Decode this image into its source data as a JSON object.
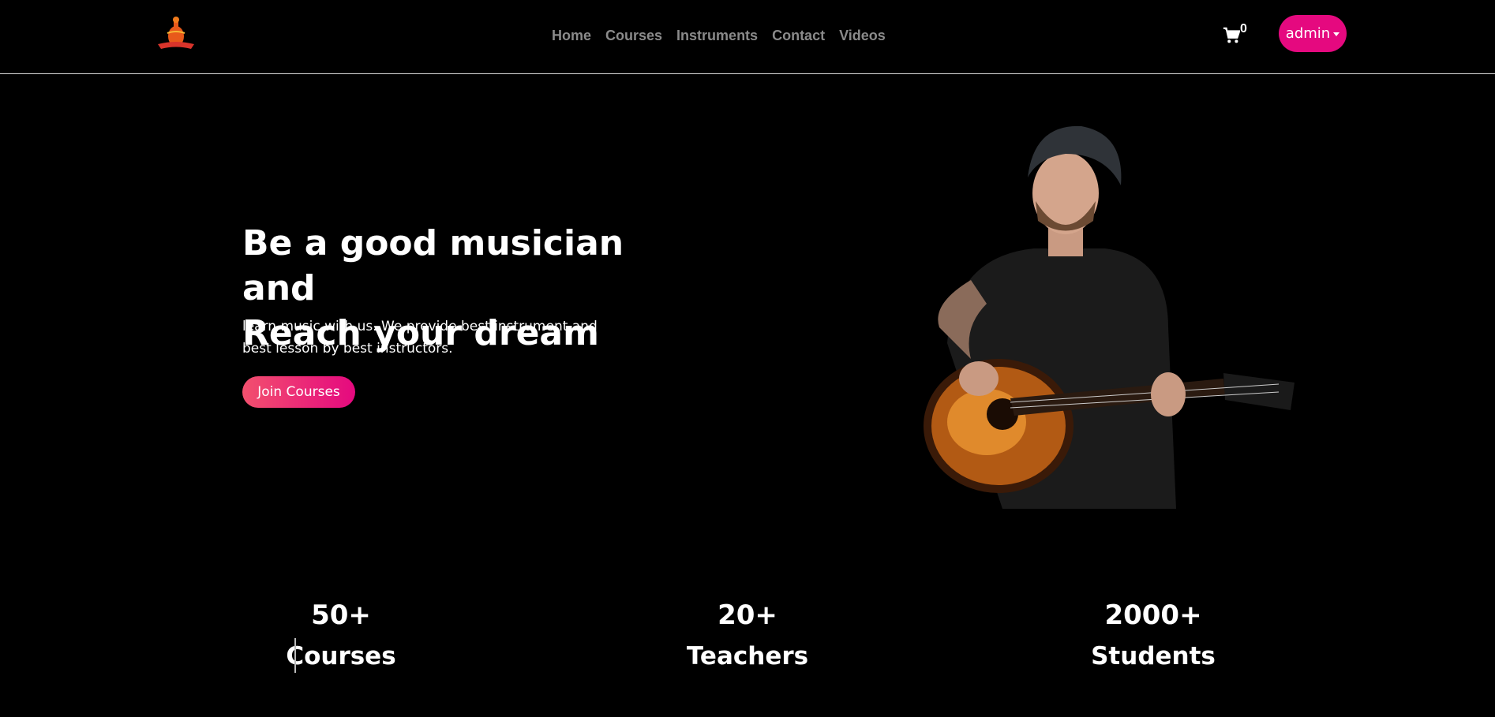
{
  "nav": {
    "links": [
      "Home",
      "Courses",
      "Instruments",
      "Contact",
      "Videos"
    ],
    "cart_count": "0",
    "user_menu_label": "admin"
  },
  "hero": {
    "title_line1": "Be a good musician and",
    "title_line2": "Reach your dream",
    "text_line1": "learn music with us. We provide best instrument and",
    "text_line2": "best lesson by best instructors.",
    "cta_label": "Join Courses"
  },
  "stats": [
    {
      "value": "50+",
      "label": "Courses"
    },
    {
      "value": "20+",
      "label": "Teachers"
    },
    {
      "value": "2000+",
      "label": "Students"
    }
  ],
  "colors": {
    "accent": "#e5097f",
    "accent_gradient_start": "#f2506e",
    "background": "#000000",
    "nav_link": "#8a8a8a"
  },
  "icons": {
    "logo": "violin-logo-icon",
    "cart": "cart-icon",
    "caret": "caret-down-icon"
  }
}
